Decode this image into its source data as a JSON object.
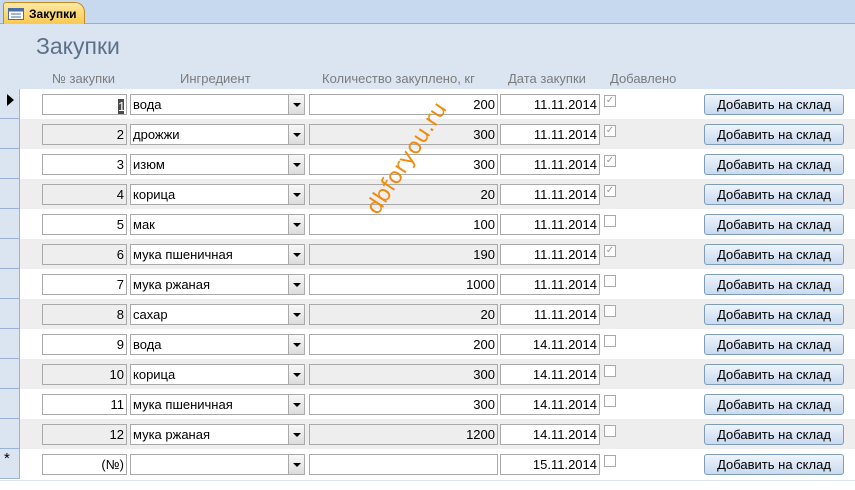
{
  "tab": {
    "label": "Закупки",
    "icon": "form-icon"
  },
  "form": {
    "title": "Закупки",
    "columns": {
      "number": "№ закупки",
      "ingredient": "Ингредиент",
      "quantity": "Количество закуплено, кг",
      "date": "Дата закупки",
      "added": "Добавлено"
    }
  },
  "rows": [
    {
      "number": "1",
      "ingredient": "вода",
      "quantity": "200",
      "date": "11.11.2014",
      "added": true,
      "button": "Добавить на склад",
      "current": true
    },
    {
      "number": "2",
      "ingredient": "дрожжи",
      "quantity": "300",
      "date": "11.11.2014",
      "added": true,
      "button": "Добавить на склад"
    },
    {
      "number": "3",
      "ingredient": "изюм",
      "quantity": "300",
      "date": "11.11.2014",
      "added": true,
      "button": "Добавить на склад"
    },
    {
      "number": "4",
      "ingredient": "корица",
      "quantity": "20",
      "date": "11.11.2014",
      "added": true,
      "button": "Добавить на склад"
    },
    {
      "number": "5",
      "ingredient": "мак",
      "quantity": "100",
      "date": "11.11.2014",
      "added": false,
      "button": "Добавить на склад"
    },
    {
      "number": "6",
      "ingredient": "мука пшеничная",
      "quantity": "190",
      "date": "11.11.2014",
      "added": true,
      "button": "Добавить на склад"
    },
    {
      "number": "7",
      "ingredient": "мука ржаная",
      "quantity": "1000",
      "date": "11.11.2014",
      "added": false,
      "button": "Добавить на склад"
    },
    {
      "number": "8",
      "ingredient": "сахар",
      "quantity": "20",
      "date": "11.11.2014",
      "added": false,
      "button": "Добавить на склад"
    },
    {
      "number": "9",
      "ingredient": "вода",
      "quantity": "200",
      "date": "14.11.2014",
      "added": false,
      "button": "Добавить на склад"
    },
    {
      "number": "10",
      "ingredient": "корица",
      "quantity": "300",
      "date": "14.11.2014",
      "added": false,
      "button": "Добавить на склад"
    },
    {
      "number": "11",
      "ingredient": "мука пшеничная",
      "quantity": "300",
      "date": "14.11.2014",
      "added": false,
      "button": "Добавить на склад"
    },
    {
      "number": "12",
      "ingredient": "мука ржаная",
      "quantity": "1200",
      "date": "14.11.2014",
      "added": false,
      "button": "Добавить на склад"
    }
  ],
  "new_row": {
    "number": "(№)",
    "ingredient": "",
    "quantity": "",
    "date": "15.11.2014",
    "added": false,
    "button": "Добавить на склад"
  },
  "watermark": "dbforyou.ru",
  "colors": {
    "header_bg": "#dbe5f1",
    "title": "#5c7189",
    "tab_active": "#f9c94d",
    "watermark": "#f08a10"
  }
}
